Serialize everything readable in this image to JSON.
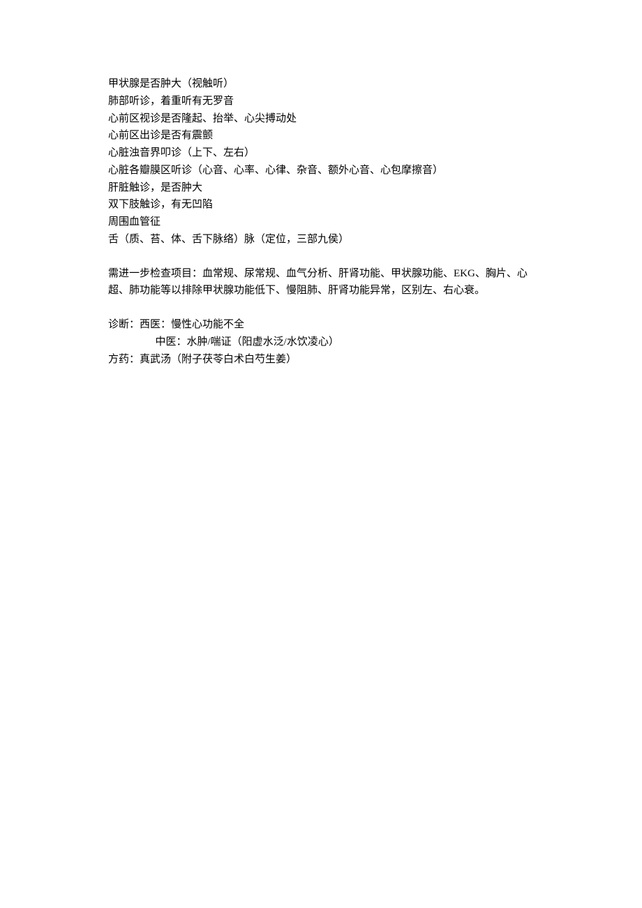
{
  "exam_items": [
    "甲状腺是否肿大（视触听）",
    "肺部听诊，着重听有无罗音",
    "心前区视诊是否隆起、抬举、心尖搏动处",
    "心前区出诊是否有震颤",
    "心脏浊音界叩诊（上下、左右）",
    "心脏各瓣膜区听诊（心音、心率、心律、杂音、额外心音、心包摩擦音）",
    "肝脏触诊，是否肿大",
    "双下肢触诊，有无凹陷",
    "周围血管征",
    "舌（质、苔、体、舌下脉络）脉（定位，三部九侯）"
  ],
  "further_tests": "需进一步检查项目：血常规、尿常规、血气分析、肝肾功能、甲状腺功能、EKG、胸片、心超、肺功能等以排除甲状腺功能低下、慢阻肺、肝肾功能异常，区别左、右心衰。",
  "diagnosis": {
    "line1": "诊断：西医：慢性心功能不全",
    "line2": "中医：水肿/喘证（阳虚水泛/水饮凌心）",
    "line3": "方药：真武汤（附子茯苓白术白芍生姜）"
  }
}
